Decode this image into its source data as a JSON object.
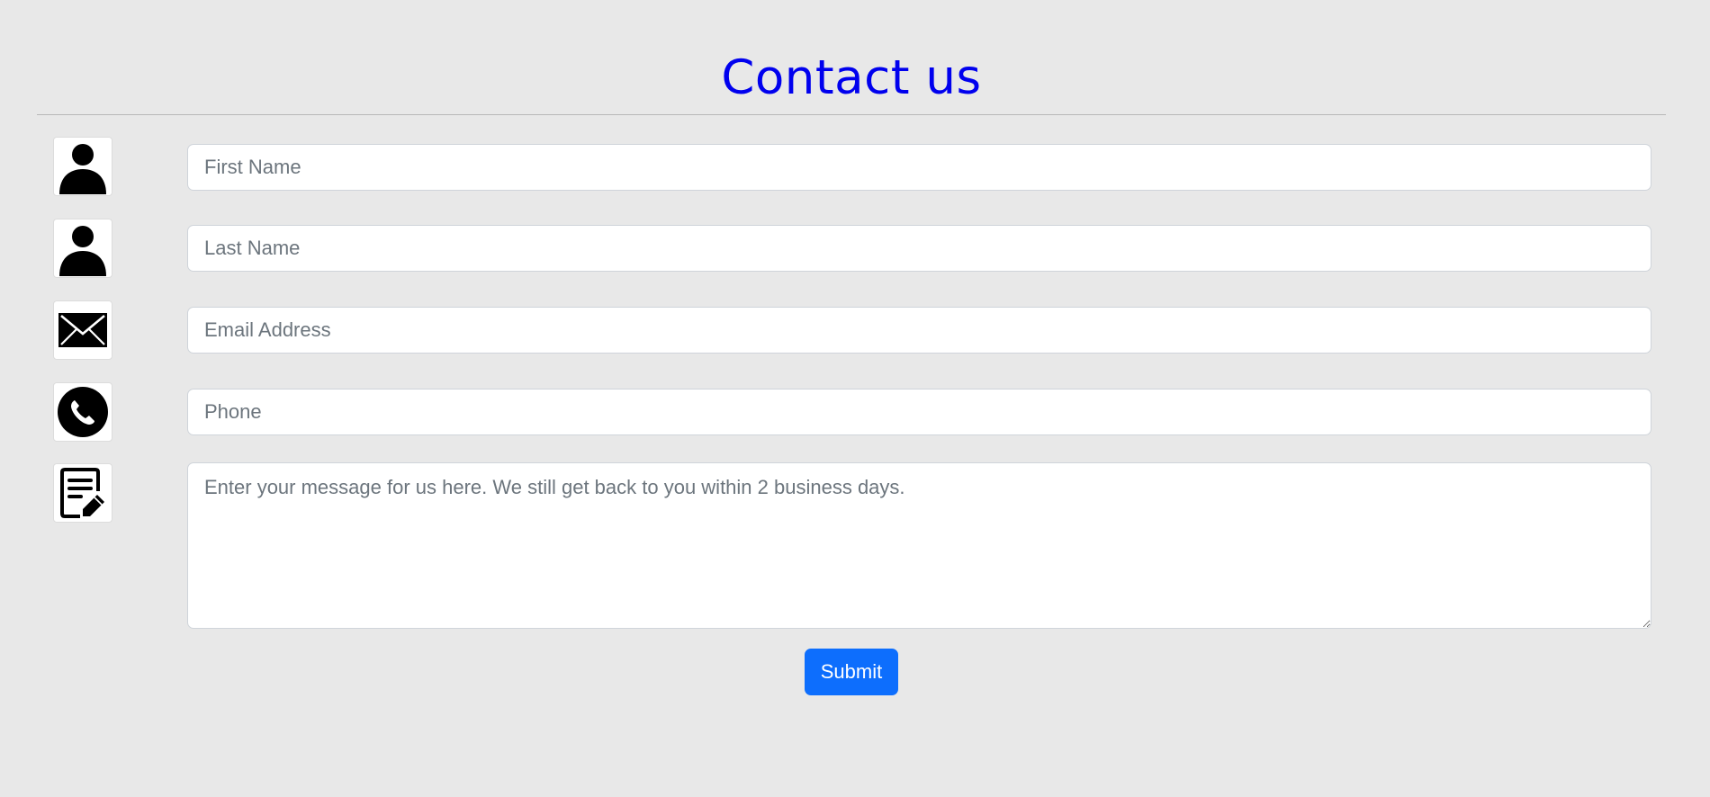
{
  "header": {
    "title": "Contact us"
  },
  "form": {
    "fields": {
      "first_name": {
        "placeholder": "First Name",
        "value": "",
        "icon": "person-icon"
      },
      "last_name": {
        "placeholder": "Last Name",
        "value": "",
        "icon": "person-icon"
      },
      "email": {
        "placeholder": "Email Address",
        "value": "",
        "icon": "envelope-icon"
      },
      "phone": {
        "placeholder": "Phone",
        "value": "",
        "icon": "phone-icon"
      },
      "message": {
        "placeholder": "Enter your message for us here. We still get back to you within 2 business days.",
        "value": "",
        "icon": "note-edit-icon"
      }
    },
    "submit_label": "Submit"
  },
  "colors": {
    "title": "#0000ee",
    "accent": "#0d6efd",
    "background": "#e8e8e8"
  }
}
